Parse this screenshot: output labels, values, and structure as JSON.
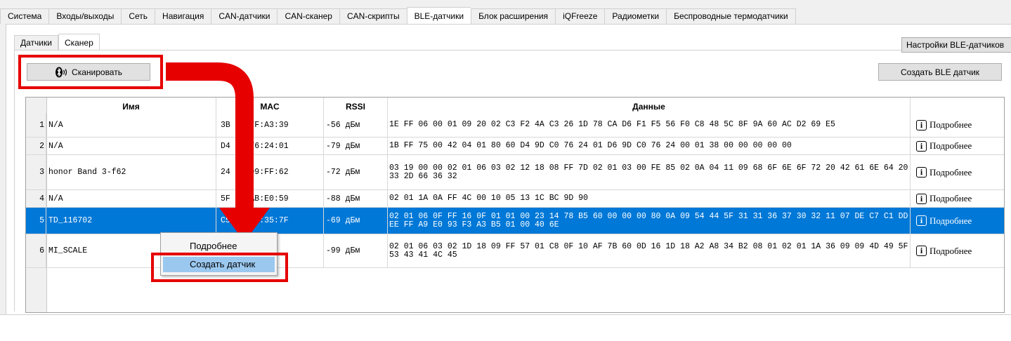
{
  "tabs": [
    "Система",
    "Входы/выходы",
    "Сеть",
    "Навигация",
    "CAN-датчики",
    "CAN-сканер",
    "CAN-скрипты",
    "BLE-датчики",
    "Блок расширения",
    "iQFreeze",
    "Радиометки",
    "Беспроводные термодатчики"
  ],
  "active_tab": "BLE-датчики",
  "subtabs": [
    "Датчики",
    "Сканер"
  ],
  "active_subtab": "Сканер",
  "buttons": {
    "settings": "Настройки BLE-датчиков",
    "scan": "Сканировать",
    "create_ble": "Создать BLE датчик"
  },
  "table": {
    "headers": {
      "name": "Имя",
      "mac": "MAC",
      "rssi": "RSSI",
      "data": "Данные"
    },
    "more_label": "Подробнее",
    "rows": [
      {
        "num": "1",
        "name": "N/A",
        "mac": "3B  C4:7F:A3:39",
        "rssi": "-56 дБм",
        "data": "1E FF 06 00 01 09 20 02 C3 F2 4A C3 26 1D 78 CA D6 F1 F5 56 F0 C8 48 5C 8F 9A 60 AC D2 69 E5"
      },
      {
        "num": "2",
        "name": "N/A",
        "mac": "D4  C0:76:24:01",
        "rssi": "-79 дБм",
        "data": "1B FF 75 00 42 04 01 80 60 D4 9D C0 76 24 01 D6 9D C0 76 24 00 01 38 00 00 00 00 00"
      },
      {
        "num": "3",
        "name": "honor Band 3-f62",
        "mac": "24  02:99:FF:62",
        "rssi": "-72 дБм",
        "data": "03 19 00 00 02 01 06 03 02 12 18 08 FF 7D 02 01 03 00 FE 85 02 0A 04 11 09 68 6F 6E 6F 72 20 42 61 6E 64 20 33 2D 66 36 32"
      },
      {
        "num": "4",
        "name": "N/A",
        "mac": "5F  C4:AB:E0:59",
        "rssi": "-88 дБм",
        "data": "02 01 1A 0A FF 4C 00 10 05 13 1C BC 9D 90"
      },
      {
        "num": "5",
        "name": "TD_116702",
        "mac": "C5  24:06:35:7F",
        "rssi": "-69 дБм",
        "data": "02 01 06 0F FF 16 0F 01 01 00 23 14 78 B5 60 00 00 00 80 0A 09 54 44 5F 31 31 36 37 30 32 11 07 DE C7 C1 DD EE FF A9 E0 93 F3 A3 B5 01 00 40 6E"
      },
      {
        "num": "6",
        "name": "MI_SCALE",
        "mac": "      7B:60",
        "rssi": "-99 дБм",
        "data": "02 01 06 03 02 1D 18 09 FF 57 01 C8 0F 10 AF 7B 60 0D 16 1D 18 A2 A8 34 B2 08 01 02 01 1A 36 09 09 4D 49 5F 53 43 41 4C 45"
      }
    ]
  },
  "context_menu": {
    "more": "Подробнее",
    "create": "Создать датчик"
  },
  "colors": {
    "selection": "#0078d7",
    "highlight_red": "#e60000",
    "menu_hover": "#9bc8ef"
  }
}
